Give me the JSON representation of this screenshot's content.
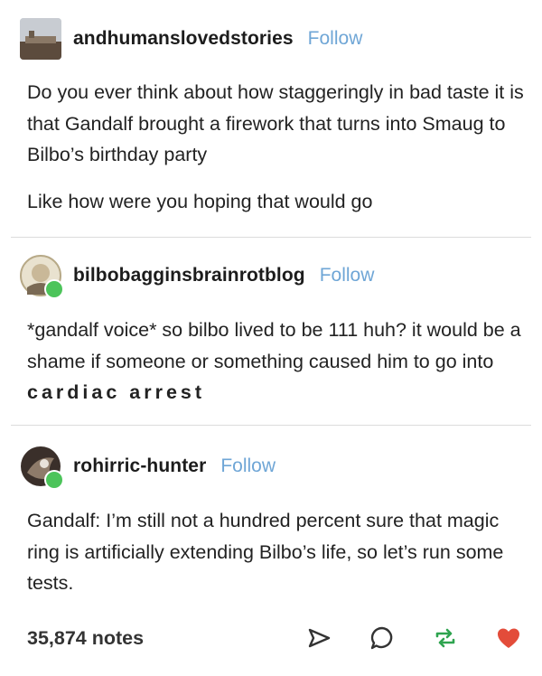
{
  "posts": [
    {
      "username": "andhumanslovedstories",
      "follow": "Follow",
      "paragraphs": [
        "Do you ever think about how staggeringly in bad taste it is that Gandalf brought a firework that turns into Smaug to Bilbo’s birthday party",
        "Like how were you hoping that would go"
      ]
    },
    {
      "username": "bilbobagginsbrainrotblog",
      "follow": "Follow",
      "text_before": "*gandalf voice* so bilbo lived to be 111 huh? it would be a shame if someone or something caused him to go into ",
      "text_spaced": "cardiac arrest"
    },
    {
      "username": "rohirric-hunter",
      "follow": "Follow",
      "text": "Gandalf: I’m still not a hundred percent sure that magic ring is artificially extending Bilbo’s life, so let’s run some tests."
    }
  ],
  "footer": {
    "notes": "35,874 notes",
    "icons": [
      "share-icon",
      "reply-icon",
      "reblog-icon",
      "like-icon"
    ],
    "like_color": "#e34c3a",
    "reblog_color": "#2ea44f"
  },
  "colors": {
    "follow": "#6fa6d6",
    "reblog_badge": "#4cc45a"
  }
}
